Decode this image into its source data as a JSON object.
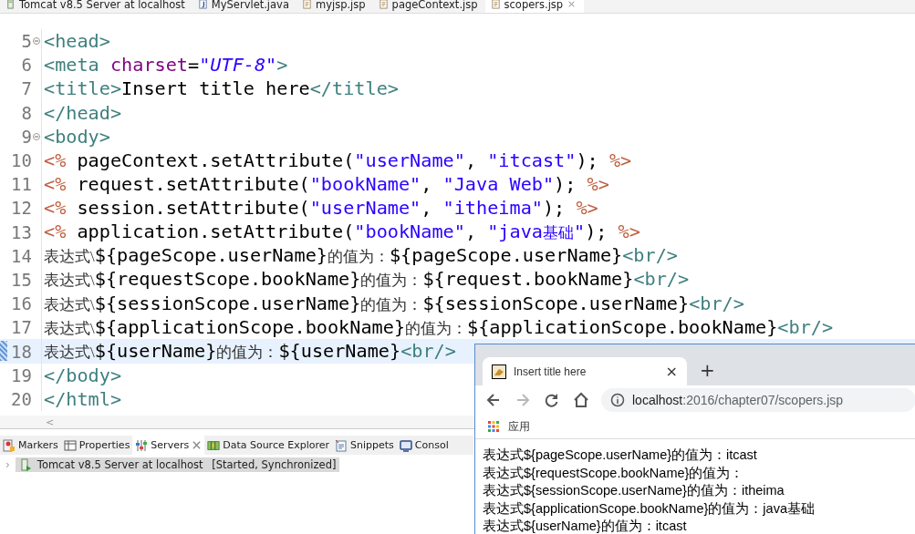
{
  "editor_tabs": [
    {
      "label": "Tomcat v8.5 Server at localhost",
      "kind": "server",
      "selected": false
    },
    {
      "label": "MyServlet.java",
      "kind": "java",
      "selected": false
    },
    {
      "label": "myjsp.jsp",
      "kind": "jsp",
      "selected": false
    },
    {
      "label": "pageContext.jsp",
      "kind": "jsp",
      "selected": false
    },
    {
      "label": "scopers.jsp",
      "kind": "jsp",
      "selected": true
    }
  ],
  "code_lines": [
    {
      "number": "5",
      "foldable": true,
      "current": false,
      "tokens": [
        {
          "kind": "tag",
          "text": "<head>"
        }
      ]
    },
    {
      "number": "6",
      "foldable": false,
      "current": false,
      "tokens": [
        {
          "kind": "tag",
          "text": "<meta "
        },
        {
          "kind": "attr",
          "text": "charset"
        },
        {
          "kind": "plain",
          "text": "="
        },
        {
          "kind": "attr-value",
          "text": "\"UTF-8\""
        },
        {
          "kind": "tag",
          "text": ">"
        }
      ]
    },
    {
      "number": "7",
      "foldable": false,
      "current": false,
      "tokens": [
        {
          "kind": "tag",
          "text": "<title>"
        },
        {
          "kind": "plain",
          "text": "Insert title here"
        },
        {
          "kind": "tag",
          "text": "</title>"
        }
      ]
    },
    {
      "number": "8",
      "foldable": false,
      "current": false,
      "tokens": [
        {
          "kind": "tag",
          "text": "</head>"
        }
      ]
    },
    {
      "number": "9",
      "foldable": true,
      "current": false,
      "tokens": [
        {
          "kind": "tag",
          "text": "<body>"
        }
      ]
    },
    {
      "number": "10",
      "foldable": false,
      "current": false,
      "tokens": [
        {
          "kind": "delim",
          "text": "<%"
        },
        {
          "kind": "plain",
          "text": " pageContext.setAttribute("
        },
        {
          "kind": "string",
          "text": "\"userName\""
        },
        {
          "kind": "plain",
          "text": ", "
        },
        {
          "kind": "string",
          "text": "\"itcast\""
        },
        {
          "kind": "plain",
          "text": "); "
        },
        {
          "kind": "delim",
          "text": "%>"
        }
      ]
    },
    {
      "number": "11",
      "foldable": false,
      "current": false,
      "tokens": [
        {
          "kind": "delim",
          "text": "<%"
        },
        {
          "kind": "plain",
          "text": " request.setAttribute("
        },
        {
          "kind": "string",
          "text": "\"bookName\""
        },
        {
          "kind": "plain",
          "text": ", "
        },
        {
          "kind": "string",
          "text": "\"Java Web\""
        },
        {
          "kind": "plain",
          "text": "); "
        },
        {
          "kind": "delim",
          "text": "%>"
        }
      ]
    },
    {
      "number": "12",
      "foldable": false,
      "current": false,
      "tokens": [
        {
          "kind": "delim",
          "text": "<%"
        },
        {
          "kind": "plain",
          "text": " session.setAttribute("
        },
        {
          "kind": "string",
          "text": "\"userName\""
        },
        {
          "kind": "plain",
          "text": ", "
        },
        {
          "kind": "string",
          "text": "\"itheima\""
        },
        {
          "kind": "plain",
          "text": "); "
        },
        {
          "kind": "delim",
          "text": "%>"
        }
      ]
    },
    {
      "number": "13",
      "foldable": false,
      "current": false,
      "tokens": [
        {
          "kind": "delim",
          "text": "<%"
        },
        {
          "kind": "plain",
          "text": " application.setAttribute("
        },
        {
          "kind": "string",
          "text": "\"bookName\""
        },
        {
          "kind": "plain",
          "text": ", "
        },
        {
          "kind": "string",
          "text": "\"java"
        },
        {
          "kind": "cjk-string",
          "text": "基础"
        },
        {
          "kind": "string",
          "text": "\""
        },
        {
          "kind": "plain",
          "text": "); "
        },
        {
          "kind": "delim",
          "text": "%>"
        }
      ]
    },
    {
      "number": "14",
      "foldable": false,
      "current": false,
      "tokens": [
        {
          "kind": "cjk",
          "text": "表达式\\"
        },
        {
          "kind": "plain",
          "text": "${pageScope.userName}"
        },
        {
          "kind": "cjk",
          "text": "的值为："
        },
        {
          "kind": "plain",
          "text": "${pageScope.userName}"
        },
        {
          "kind": "tag",
          "text": "<br/>"
        }
      ]
    },
    {
      "number": "15",
      "foldable": false,
      "current": false,
      "tokens": [
        {
          "kind": "cjk",
          "text": "表达式\\"
        },
        {
          "kind": "plain",
          "text": "${requestScope.bookName}"
        },
        {
          "kind": "cjk",
          "text": "的值为："
        },
        {
          "kind": "plain",
          "text": "${request.bookName}"
        },
        {
          "kind": "tag",
          "text": "<br/>"
        }
      ]
    },
    {
      "number": "16",
      "foldable": false,
      "current": false,
      "tokens": [
        {
          "kind": "cjk",
          "text": "表达式\\"
        },
        {
          "kind": "plain",
          "text": "${sessionScope.userName}"
        },
        {
          "kind": "cjk",
          "text": "的值为："
        },
        {
          "kind": "plain",
          "text": "${sessionScope.userName}"
        },
        {
          "kind": "tag",
          "text": "<br/>"
        }
      ]
    },
    {
      "number": "17",
      "foldable": false,
      "current": false,
      "tokens": [
        {
          "kind": "cjk",
          "text": "表达式\\"
        },
        {
          "kind": "plain",
          "text": "${applicationScope.bookName}"
        },
        {
          "kind": "cjk",
          "text": "的值为："
        },
        {
          "kind": "plain",
          "text": "${applicationScope.bookName}"
        },
        {
          "kind": "tag",
          "text": "<br/>"
        }
      ]
    },
    {
      "number": "18",
      "foldable": false,
      "current": true,
      "tokens": [
        {
          "kind": "cjk",
          "text": "表达式\\"
        },
        {
          "kind": "plain",
          "text": "${userName}"
        },
        {
          "kind": "cjk",
          "text": "的值为："
        },
        {
          "kind": "plain",
          "text": "${userName}"
        },
        {
          "kind": "tag",
          "text": "<br/>"
        }
      ]
    },
    {
      "number": "19",
      "foldable": false,
      "current": false,
      "tokens": [
        {
          "kind": "tag",
          "text": "</body>"
        }
      ]
    },
    {
      "number": "20",
      "foldable": false,
      "current": false,
      "tokens": [
        {
          "kind": "tag",
          "text": "</html>"
        }
      ]
    }
  ],
  "scroll_left": "<",
  "bottom_panel": {
    "tabs": [
      {
        "label": "Markers",
        "kind": "markers",
        "selected": false,
        "closable": false
      },
      {
        "label": "Properties",
        "kind": "properties",
        "selected": false,
        "closable": false
      },
      {
        "label": "Servers",
        "kind": "servers",
        "selected": true,
        "closable": true
      },
      {
        "label": "Data Source Explorer",
        "kind": "datasource",
        "selected": false,
        "closable": false
      },
      {
        "label": "Snippets",
        "kind": "snippets",
        "selected": false,
        "closable": false
      },
      {
        "label": "Consol",
        "kind": "console",
        "selected": false,
        "closable": false
      }
    ],
    "servers": [
      {
        "chevron": "›",
        "name": "Tomcat v8.5 Server at localhost",
        "status": "[Started, Synchronized]",
        "expanded": false,
        "selected": true
      }
    ]
  },
  "browser": {
    "tab_title": "Insert title here",
    "tab_close": "×",
    "new_tab": "+",
    "host": "localhost",
    "path": ":2016/chapter07/scopers.jsp",
    "forward_disabled": true,
    "bookmarks": [
      {
        "label": "应用"
      }
    ],
    "content_lines": [
      "表达式${pageScope.userName}的值为：itcast",
      "表达式${requestScope.bookName}的值为：",
      "表达式${sessionScope.userName}的值为：itheima",
      "表达式${applicationScope.bookName}的值为：java基础",
      "表达式${userName}的值为：itcast"
    ]
  }
}
